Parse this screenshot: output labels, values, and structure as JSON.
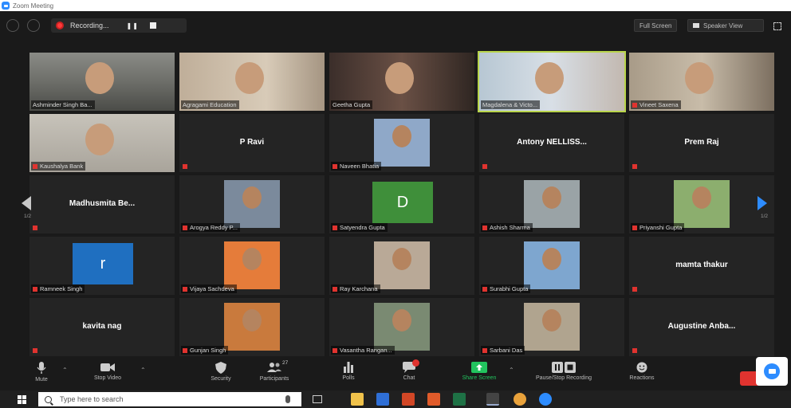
{
  "window": {
    "title": "Zoom Meeting"
  },
  "topbar": {
    "recording_label": "Recording...",
    "pause_glyph": "❚❚",
    "right_button_1": "Full Screen",
    "right_button_2": "Speaker View"
  },
  "pagination": {
    "left": "1/2",
    "right": "1/2"
  },
  "participants": [
    {
      "name": "Ashminder Singh Ba...",
      "kind": "video",
      "style": "v1"
    },
    {
      "name": "Agragami Education",
      "kind": "video",
      "style": "v2"
    },
    {
      "name": "Geetha Gupta",
      "kind": "video",
      "style": "v3"
    },
    {
      "name": "Magdalena & Victo...",
      "kind": "video",
      "style": "v4",
      "active": true
    },
    {
      "name": "Vineet Saxena",
      "kind": "video",
      "style": "v5"
    },
    {
      "name": "Kaushalya Bank",
      "kind": "video",
      "style": "v6"
    },
    {
      "name": "P Ravi",
      "kind": "name"
    },
    {
      "name": "Naveen Bhatia",
      "kind": "photo",
      "color": "#8fa8c8"
    },
    {
      "name": "Antony NELLISS...",
      "kind": "name"
    },
    {
      "name": "Prem Raj",
      "kind": "name"
    },
    {
      "name": "Madhusmita Be...",
      "kind": "name"
    },
    {
      "name": "Arogya Reddy P...",
      "kind": "photo",
      "color": "#7b8a9c"
    },
    {
      "name": "Satyendra Gupta",
      "kind": "letter",
      "letter": "D",
      "color": "#3f8f3a"
    },
    {
      "name": "Ashish Sharma",
      "kind": "photo",
      "color": "#9aa3a6"
    },
    {
      "name": "Priyanshi Gupta",
      "kind": "photo",
      "color": "#8cae6e"
    },
    {
      "name": "Ramneek Singh",
      "kind": "letter",
      "letter": "r",
      "color": "#1f6fc0"
    },
    {
      "name": "Vijaya Sachdeva",
      "kind": "photo",
      "color": "#e57c3a"
    },
    {
      "name": "Ray Karchana",
      "kind": "photo",
      "color": "#b9a997"
    },
    {
      "name": "Surabhi Gupta",
      "kind": "photo",
      "color": "#7ea6cf"
    },
    {
      "name": "mamta thakur",
      "kind": "name"
    },
    {
      "name": "kavita nag",
      "kind": "name"
    },
    {
      "name": "Gunjan Singh",
      "kind": "photo",
      "color": "#c97a3d"
    },
    {
      "name": "Vasantha Rangan...",
      "kind": "photo",
      "color": "#7a8a72"
    },
    {
      "name": "Sarbani Das",
      "kind": "photo",
      "color": "#b0a48f"
    },
    {
      "name": "Augustine Anba...",
      "kind": "name"
    }
  ],
  "toolbar": {
    "mute": "Mute",
    "stop_video": "Stop Video",
    "security": "Security",
    "participants": "Participants",
    "participants_count": "27",
    "polls": "Polls",
    "chat": "Chat",
    "share_screen": "Share Screen",
    "pause_recording": "Pause/Stop Recording",
    "reactions": "Reactions"
  },
  "taskbar": {
    "search_placeholder": "Type here to search"
  },
  "colors": {
    "background": "#1a1a1a",
    "tile": "#242424",
    "active_speaker": "#b8d44a",
    "share_screen": "#22c35e",
    "muted": "#e0332f",
    "zoom_blue": "#2d8cff"
  }
}
